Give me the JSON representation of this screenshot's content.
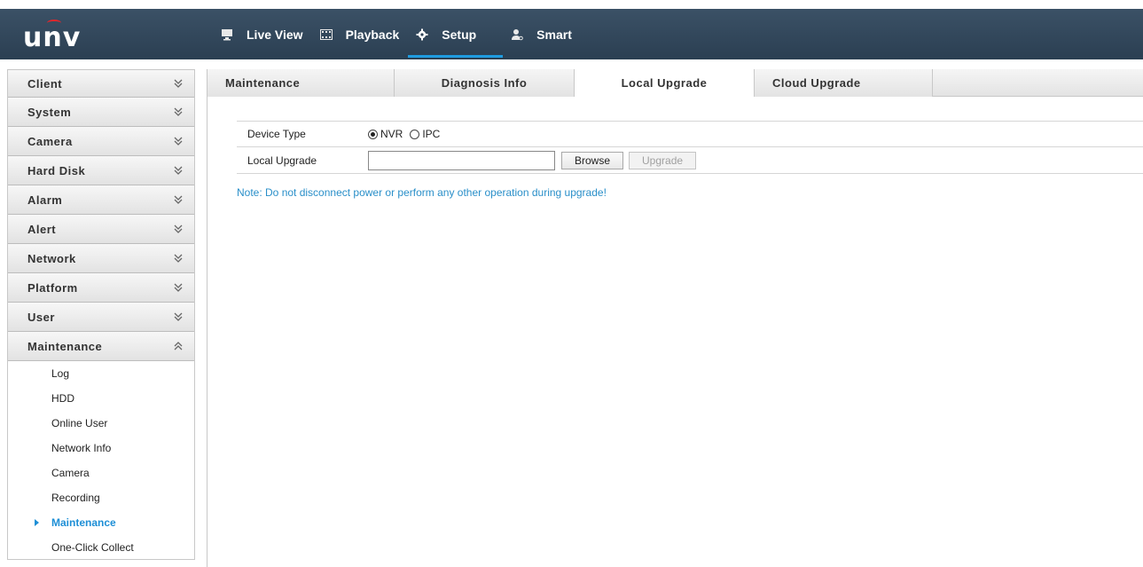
{
  "header": {
    "logo_text": "unv",
    "nav": [
      {
        "label": "Live View",
        "icon": "monitor-icon"
      },
      {
        "label": "Playback",
        "icon": "film-icon"
      },
      {
        "label": "Setup",
        "icon": "gear-icon"
      },
      {
        "label": "Smart",
        "icon": "smart-person-icon"
      }
    ],
    "active_nav": "Setup"
  },
  "sidebar": {
    "sections": [
      {
        "label": "Client",
        "expanded": false
      },
      {
        "label": "System",
        "expanded": false
      },
      {
        "label": "Camera",
        "expanded": false
      },
      {
        "label": "Hard Disk",
        "expanded": false
      },
      {
        "label": "Alarm",
        "expanded": false
      },
      {
        "label": "Alert",
        "expanded": false
      },
      {
        "label": "Network",
        "expanded": false
      },
      {
        "label": "Platform",
        "expanded": false
      },
      {
        "label": "User",
        "expanded": false
      },
      {
        "label": "Maintenance",
        "expanded": true
      }
    ],
    "maintenance_items": [
      {
        "label": "Log"
      },
      {
        "label": "HDD"
      },
      {
        "label": "Online User"
      },
      {
        "label": "Network Info"
      },
      {
        "label": "Camera"
      },
      {
        "label": "Recording"
      },
      {
        "label": "Maintenance"
      },
      {
        "label": "One-Click Collect"
      }
    ],
    "active_item": "Maintenance"
  },
  "tabs": [
    {
      "label": "Maintenance"
    },
    {
      "label": "Diagnosis Info"
    },
    {
      "label": "Local Upgrade"
    },
    {
      "label": "Cloud Upgrade"
    }
  ],
  "active_tab": "Local Upgrade",
  "form": {
    "device_type_label": "Device Type",
    "device_type_options": [
      {
        "label": "NVR",
        "selected": true
      },
      {
        "label": "IPC",
        "selected": false
      }
    ],
    "local_upgrade_label": "Local Upgrade",
    "file_value": "",
    "browse_label": "Browse",
    "upgrade_label": "Upgrade"
  },
  "note": "Note: Do not disconnect power or perform any other operation during upgrade!",
  "colors": {
    "topbar": "#2e4256",
    "accent": "#1e9be0",
    "note": "#2a8fc9"
  }
}
